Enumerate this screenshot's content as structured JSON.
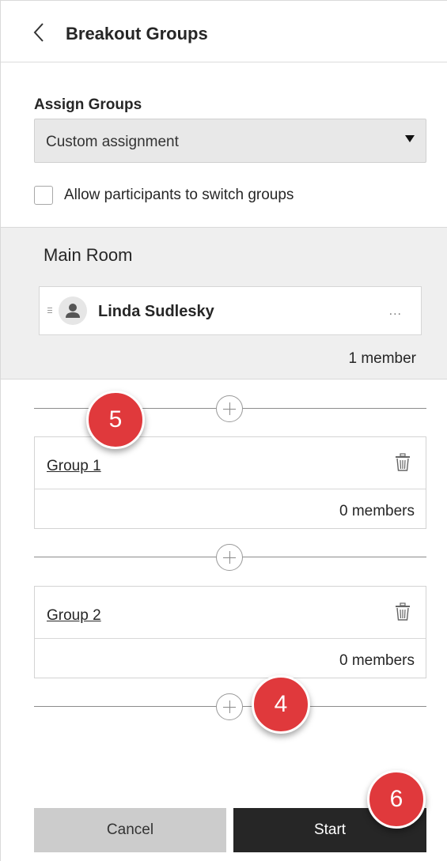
{
  "header": {
    "title": "Breakout Groups"
  },
  "assign": {
    "label": "Assign Groups",
    "selected": "Custom assignment"
  },
  "switch_option": {
    "label": "Allow participants to switch groups",
    "checked": false
  },
  "main_room": {
    "title": "Main Room",
    "members": [
      {
        "name": "Linda Sudlesky",
        "more": "..."
      }
    ],
    "count": "1 member"
  },
  "groups": [
    {
      "name": "Group 1",
      "count": "0 members"
    },
    {
      "name": "Group 2",
      "count": "0 members"
    }
  ],
  "buttons": {
    "cancel": "Cancel",
    "start": "Start"
  },
  "callouts": [
    "5",
    "4",
    "6"
  ],
  "colors": {
    "callout": "#e0393c",
    "start_bg": "#262626",
    "cancel_bg": "#cccccc",
    "main_room_bg": "#efefef"
  }
}
